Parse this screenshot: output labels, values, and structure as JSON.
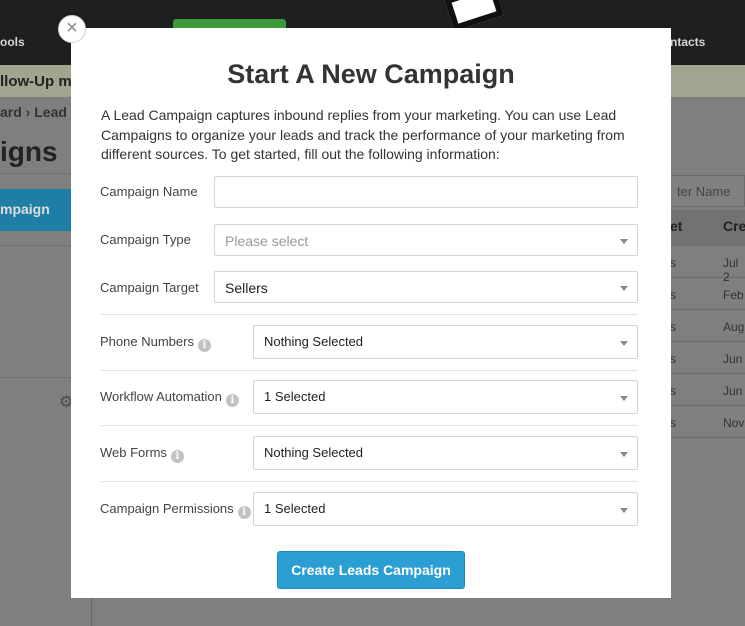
{
  "background": {
    "nav_tools": "ools",
    "nav_contacts": "ntacts",
    "followup_banner": "llow-Up m",
    "breadcrumb": "ard  ›  Lead",
    "page_heading": "igns",
    "side_button": "mpaign",
    "filter_placeholder": "ter Name",
    "columns": [
      "et",
      "Cre"
    ],
    "rows": [
      {
        "c1": "s",
        "c2": "Jul 2"
      },
      {
        "c1": "s",
        "c2": "Feb"
      },
      {
        "c1": "s",
        "c2": "Aug"
      },
      {
        "c1": "s",
        "c2": "Jun"
      },
      {
        "c1": "s",
        "c2": "Jun"
      },
      {
        "c1": "s",
        "c2": "Nov"
      }
    ]
  },
  "modal": {
    "close_glyph": "×",
    "title": "Start A New Campaign",
    "intro": "A Lead Campaign captures inbound replies from your marketing. You can use Lead Campaigns to organize your leads and track the performance of your marketing from different sources. To get started, fill out the following information:",
    "fields": {
      "campaign_name": {
        "label": "Campaign Name",
        "value": ""
      },
      "campaign_type": {
        "label": "Campaign Type",
        "placeholder": "Please select"
      },
      "campaign_target": {
        "label": "Campaign Target",
        "value": "Sellers"
      },
      "phone_numbers": {
        "label": "Phone Numbers",
        "value": "Nothing Selected"
      },
      "workflow_automation": {
        "label": "Workflow Automation",
        "value": "1 Selected"
      },
      "web_forms": {
        "label": "Web Forms",
        "value": "Nothing Selected"
      },
      "campaign_permissions": {
        "label": "Campaign Permissions",
        "value": "1 Selected"
      }
    },
    "info_glyph": "i",
    "submit_label": "Create Leads Campaign"
  },
  "colors": {
    "primary_button": "#2b9fd4",
    "overlay": "#7f7f7f",
    "modal_bg": "#ffffff"
  }
}
